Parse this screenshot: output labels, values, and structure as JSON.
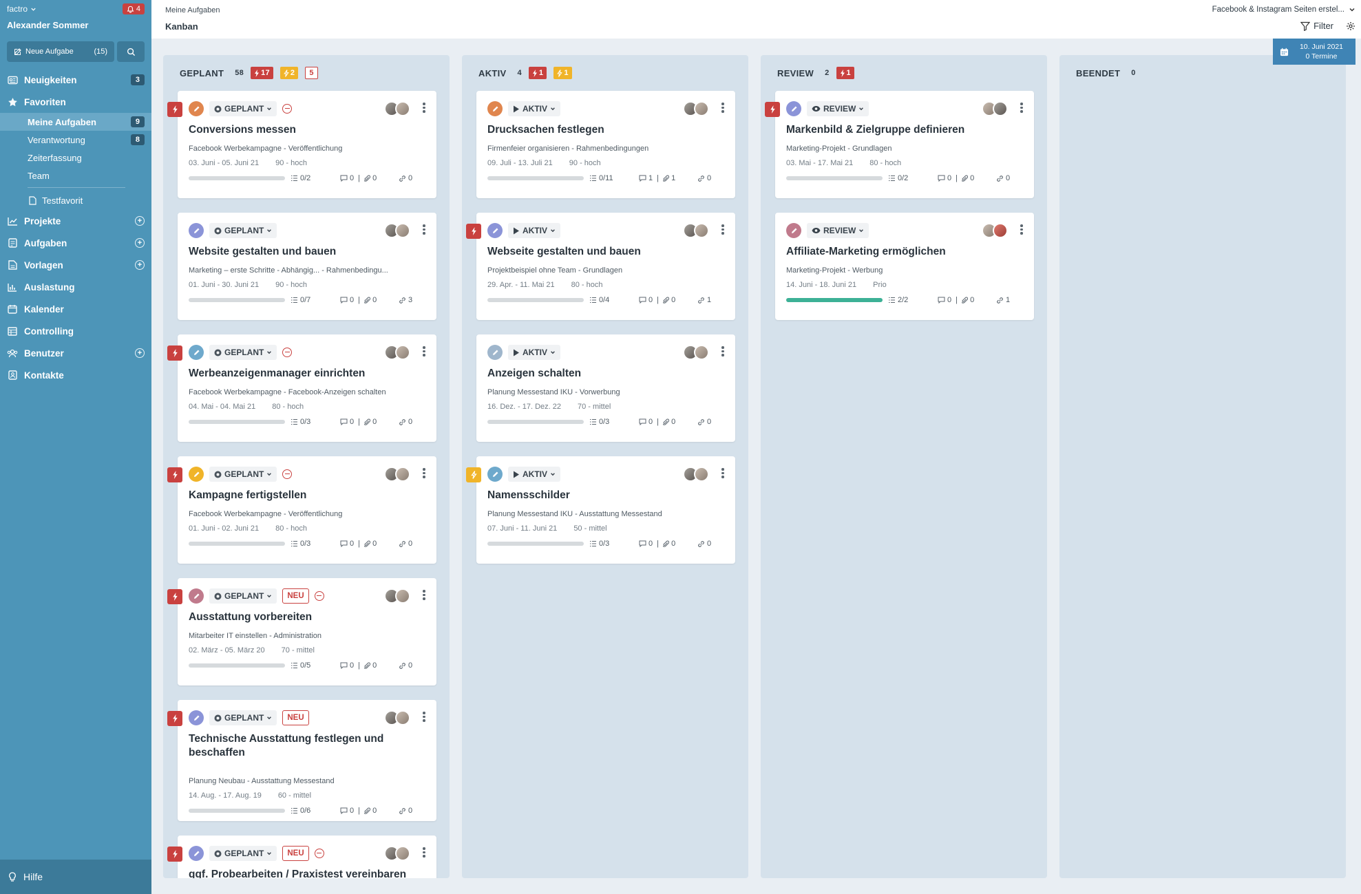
{
  "sidebar": {
    "brand": "factro",
    "user": "Alexander Sommer",
    "bell_count": "4",
    "new_task": {
      "label": "Neue Aufgabe",
      "count": "(15)"
    },
    "nav": {
      "neuigkeiten": {
        "label": "Neuigkeiten",
        "count": "3"
      },
      "favoriten": {
        "label": "Favoriten"
      },
      "meine": {
        "label": "Meine Aufgaben",
        "count": "9"
      },
      "verantwortung": {
        "label": "Verantwortung",
        "count": "8"
      },
      "zeiterfassung": {
        "label": "Zeiterfassung"
      },
      "team": {
        "label": "Team"
      },
      "testfavorit": {
        "label": "Testfavorit"
      },
      "projekte": {
        "label": "Projekte"
      },
      "aufgaben": {
        "label": "Aufgaben"
      },
      "vorlagen": {
        "label": "Vorlagen"
      },
      "auslastung": {
        "label": "Auslastung"
      },
      "kalender": {
        "label": "Kalender"
      },
      "controlling": {
        "label": "Controlling"
      },
      "benutzer": {
        "label": "Benutzer"
      },
      "kontakte": {
        "label": "Kontakte"
      }
    },
    "help": "Hilfe"
  },
  "header": {
    "breadcrumb": "Meine Aufgaben",
    "title": "Kanban",
    "project": "Facebook & Instagram Seiten erstel...",
    "filter": "Filter",
    "date": "10. Juni 2021",
    "termine": "0 Termine"
  },
  "columns": [
    {
      "name": "GEPLANT",
      "count": "58",
      "flags": "17",
      "warn": "2",
      "outline": "5"
    },
    {
      "name": "AKTIV",
      "count": "4",
      "flags": "1",
      "warn": "1"
    },
    {
      "name": "REVIEW",
      "count": "2",
      "flags": "1"
    },
    {
      "name": "BEENDET",
      "count": "0"
    }
  ],
  "colors": {
    "sidebar": "#4d95b8",
    "red": "#c9413f",
    "yellow": "#f0b429",
    "green": "#3db196"
  },
  "cards": {
    "g1": {
      "status": "GEPLANT",
      "title": "Conversions messen",
      "sub": "Facebook Werbekampagne - Veröffentlichung",
      "date": "03. Juni - 05. Juni 21",
      "prio": "90 - hoch",
      "checks": "0/2",
      "comments": "0",
      "files": "0",
      "links": "0",
      "progress": 0
    },
    "g2": {
      "status": "GEPLANT",
      "title": "Website gestalten und bauen",
      "sub": "Marketing – erste Schritte - Abhängig... - Rahmenbedingu...",
      "date": "01. Juni - 30. Juni 21",
      "prio": "90 - hoch",
      "checks": "0/7",
      "comments": "0",
      "files": "0",
      "links": "3",
      "progress": 0
    },
    "g3": {
      "status": "GEPLANT",
      "title": "Werbeanzeigenmanager einrichten",
      "sub": "Facebook Werbekampagne - Facebook-Anzeigen schalten",
      "date": "04. Mai - 04. Mai 21",
      "prio": "80 - hoch",
      "checks": "0/3",
      "comments": "0",
      "files": "0",
      "links": "0",
      "progress": 0
    },
    "g4": {
      "status": "GEPLANT",
      "title": "Kampagne fertigstellen",
      "sub": "Facebook Werbekampagne - Veröffentlichung",
      "date": "01. Juni - 02. Juni 21",
      "prio": "80 - hoch",
      "checks": "0/3",
      "comments": "0",
      "files": "0",
      "links": "0",
      "progress": 0
    },
    "g5": {
      "status": "GEPLANT",
      "neu": "NEU",
      "title": "Ausstattung vorbereiten",
      "sub": "Mitarbeiter IT einstellen - Administration",
      "date": "02. März - 05. März 20",
      "prio": "70 - mittel",
      "checks": "0/5",
      "comments": "0",
      "files": "0",
      "links": "0",
      "progress": 0
    },
    "g6": {
      "status": "GEPLANT",
      "neu": "NEU",
      "title": "Technische Ausstattung festlegen und beschaffen",
      "sub": "Planung Neubau - Ausstattung Messestand",
      "date": "14. Aug. - 17. Aug. 19",
      "prio": "60 - mittel",
      "checks": "0/6",
      "comments": "0",
      "files": "0",
      "links": "0",
      "progress": 0
    },
    "g7": {
      "status": "GEPLANT",
      "neu": "NEU",
      "title": "ggf. Probearbeiten / Praxistest vereinbaren"
    },
    "a1": {
      "status": "AKTIV",
      "title": "Drucksachen festlegen",
      "sub": "Firmenfeier organisieren - Rahmenbedingungen",
      "date": "09. Juli - 13. Juli 21",
      "prio": "90 - hoch",
      "checks": "0/11",
      "comments": "1",
      "files": "1",
      "links": "0",
      "progress": 0
    },
    "a2": {
      "status": "AKTIV",
      "title": "Webseite gestalten und bauen",
      "sub": "Projektbeispiel ohne Team - Grundlagen",
      "date": "29. Apr. - 11. Mai 21",
      "prio": "80 - hoch",
      "checks": "0/4",
      "comments": "0",
      "files": "0",
      "links": "1",
      "progress": 0
    },
    "a3": {
      "status": "AKTIV",
      "title": "Anzeigen schalten",
      "sub": "Planung Messestand IKU - Vorwerbung",
      "date": "16. Dez. - 17. Dez. 22",
      "prio": "70 - mittel",
      "checks": "0/3",
      "comments": "0",
      "files": "0",
      "links": "0",
      "progress": 0
    },
    "a4": {
      "status": "AKTIV",
      "title": "Namensschilder",
      "sub": "Planung Messestand IKU - Ausstattung Messestand",
      "date": "07. Juni - 11. Juni 21",
      "prio": "50 - mittel",
      "checks": "0/3",
      "comments": "0",
      "files": "0",
      "links": "0",
      "progress": 0
    },
    "r1": {
      "status": "REVIEW",
      "title": "Markenbild & Zielgruppe definieren",
      "sub": "Marketing-Projekt - Grundlagen",
      "date": "03. Mai - 17. Mai 21",
      "prio": "80 - hoch",
      "checks": "0/2",
      "comments": "0",
      "files": "0",
      "links": "0",
      "progress": 0
    },
    "r2": {
      "status": "REVIEW",
      "title": "Affiliate-Marketing ermöglichen",
      "sub": "Marketing-Projekt - Werbung",
      "date": "14. Juni - 18. Juni 21",
      "prio": "Prio",
      "checks": "2/2",
      "comments": "0",
      "files": "0",
      "links": "1",
      "progress": 1
    }
  }
}
